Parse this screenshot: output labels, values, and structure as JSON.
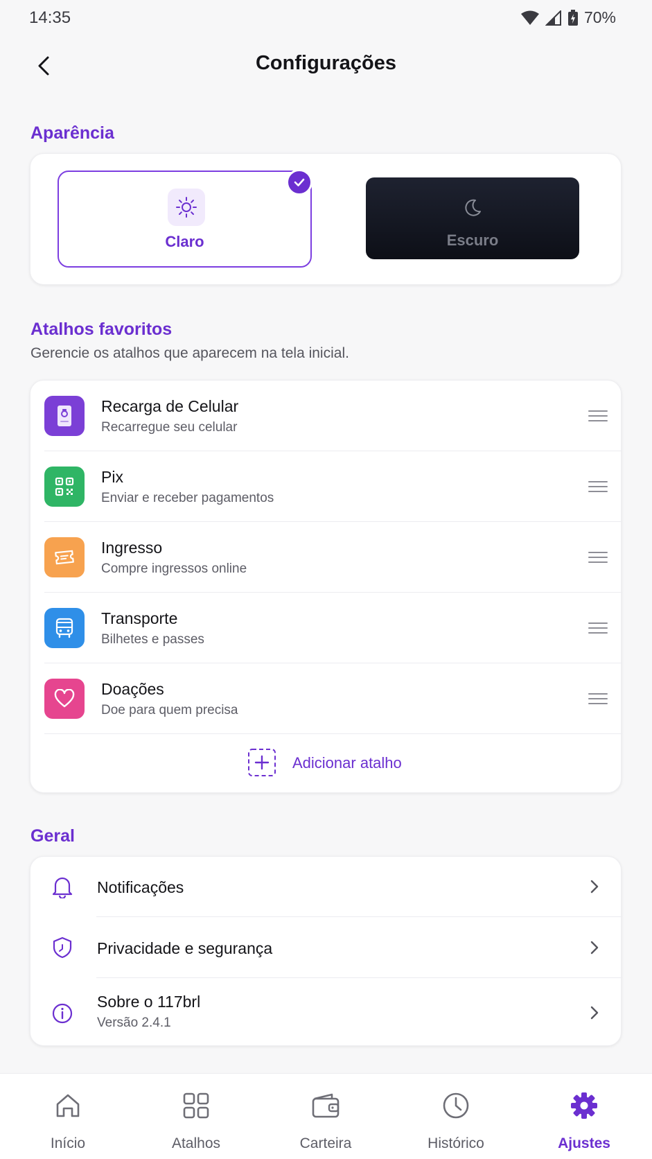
{
  "status_bar": {
    "time": "14:35",
    "battery": "70%"
  },
  "header": {
    "title": "Configurações"
  },
  "appearance": {
    "section_title": "Aparência",
    "light_label": "Claro",
    "dark_label": "Escuro",
    "selected": "light"
  },
  "shortcuts": {
    "section_title": "Atalhos favoritos",
    "subtitle": "Gerencie os atalhos que aparecem na tela inicial.",
    "items": [
      {
        "title": "Recarga de Celular",
        "subtitle": "Recarregue seu celular",
        "icon": "phone-recharge-icon",
        "color": "#7b3fd6"
      },
      {
        "title": "Pix",
        "subtitle": "Enviar e receber pagamentos",
        "icon": "qr-code-icon",
        "color": "#2fb565"
      },
      {
        "title": "Ingresso",
        "subtitle": "Compre ingressos online",
        "icon": "ticket-icon",
        "color": "#f7a24f"
      },
      {
        "title": "Transporte",
        "subtitle": "Bilhetes e passes",
        "icon": "bus-icon",
        "color": "#2f8fe8"
      },
      {
        "title": "Doações",
        "subtitle": "Doe para quem precisa",
        "icon": "heart-icon",
        "color": "#e6458f"
      }
    ],
    "add_label": "Adicionar atalho"
  },
  "general": {
    "section_title": "Geral",
    "items": [
      {
        "title": "Notificações",
        "icon": "bell-icon"
      },
      {
        "title": "Privacidade e segurança",
        "icon": "shield-icon"
      },
      {
        "title": "Sobre o 117brl",
        "subtitle": "Versão 2.4.1",
        "icon": "info-icon"
      }
    ]
  },
  "nav": {
    "items": [
      {
        "label": "Início",
        "icon": "home-icon"
      },
      {
        "label": "Atalhos",
        "icon": "grid-icon"
      },
      {
        "label": "Carteira",
        "icon": "wallet-icon"
      },
      {
        "label": "Histórico",
        "icon": "clock-icon"
      },
      {
        "label": "Ajustes",
        "icon": "gear-icon"
      }
    ],
    "active": "Ajustes"
  },
  "colors": {
    "accent": "#6b2fd0",
    "background": "#f7f7f8"
  }
}
